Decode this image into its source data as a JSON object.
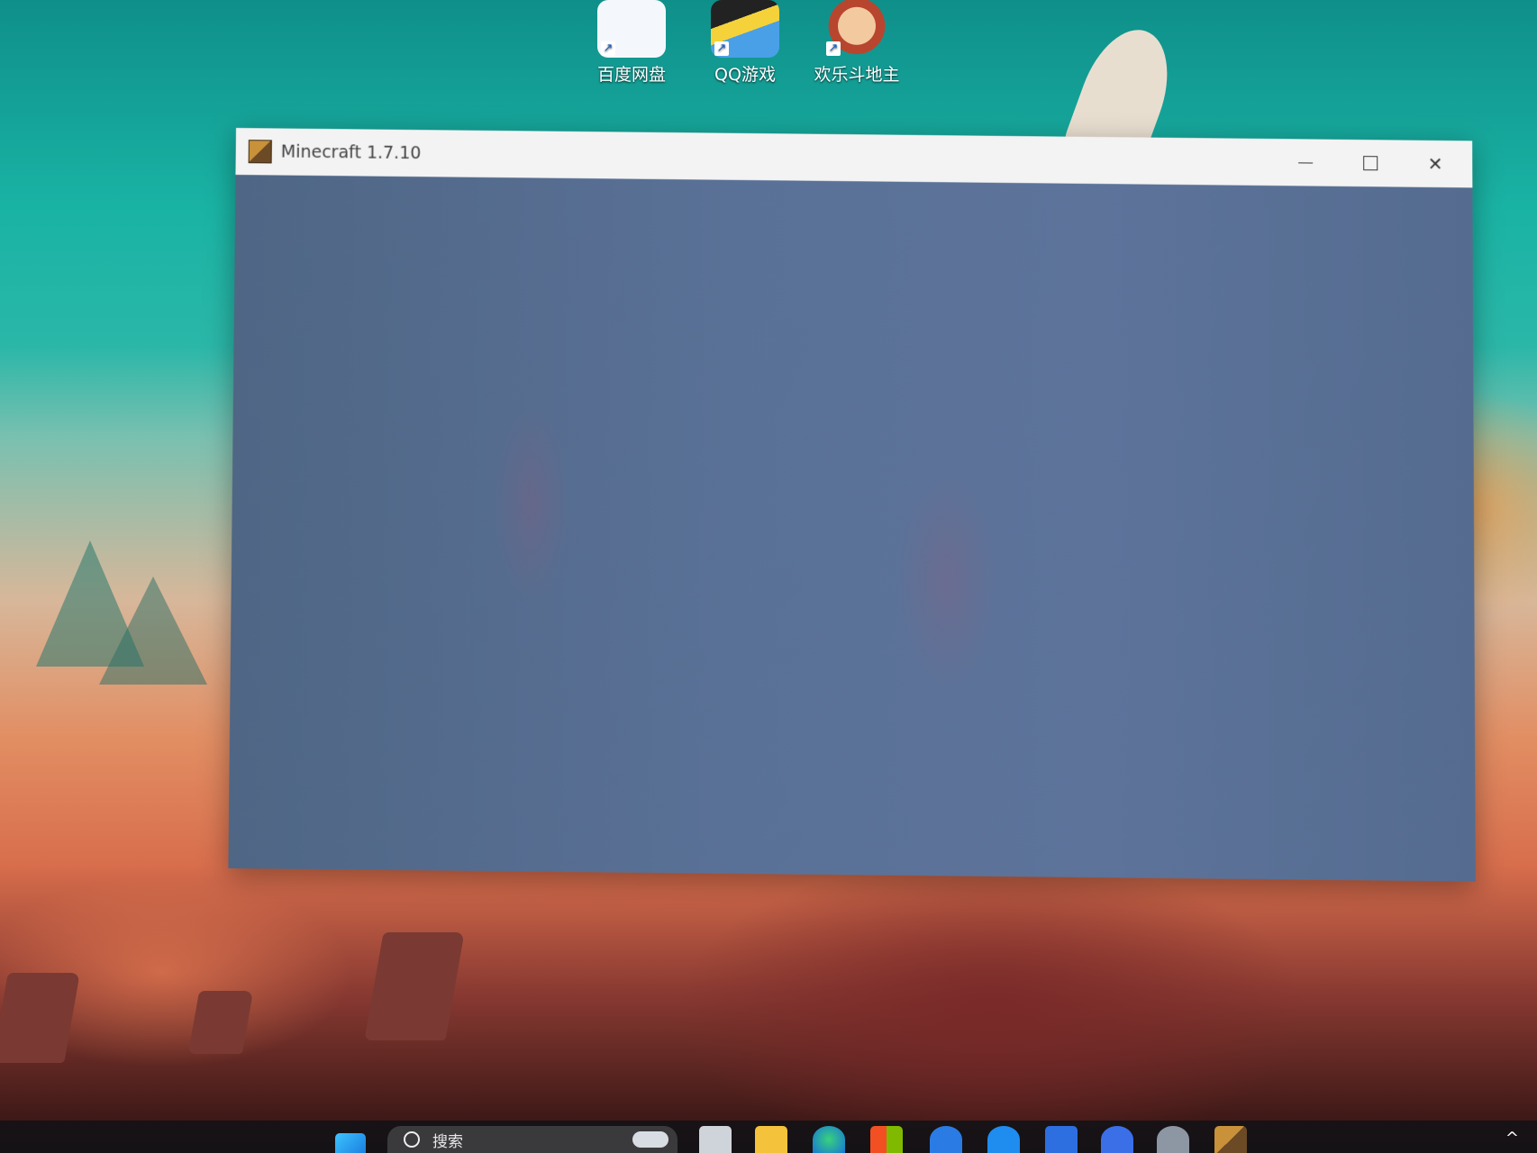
{
  "desktop": {
    "icons": [
      {
        "label": "百度网盘",
        "icon": "baidu-netdisk-icon"
      },
      {
        "label": "QQ游戏",
        "icon": "qq-games-icon"
      },
      {
        "label": "欢乐斗地主",
        "icon": "happy-landlord-icon"
      }
    ]
  },
  "window": {
    "title": "Minecraft 1.7.10",
    "icon": "minecraft-block-icon",
    "controls": {
      "minimize": "minimize-icon",
      "maximize": "maximize-icon",
      "close": "close-icon",
      "close_glyph": "✕"
    },
    "client_color": "#5a7197"
  },
  "taskbar": {
    "search_text": "搜索",
    "tray_chevron": "^",
    "apps": [
      "windows-start-icon",
      "weather-icon",
      "task-view-icon",
      "file-explorer-icon",
      "edge-browser-icon",
      "microsoft-store-icon",
      "kugou-icon",
      "thunder-icon",
      "capture-icon",
      "onedrive-icon",
      "settings-gear-icon",
      "minecraft-icon"
    ]
  }
}
